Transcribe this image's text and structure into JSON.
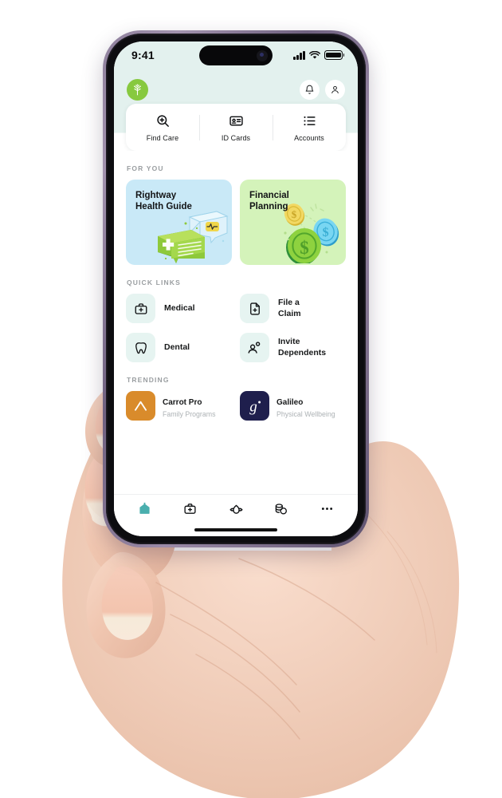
{
  "device": {
    "frame_color": "#7b6c8a",
    "bezel_color": "#0d0d10"
  },
  "status_bar": {
    "time": "9:41",
    "signal_icon": "cellular-bars-icon",
    "wifi_icon": "wifi-icon",
    "battery_icon": "battery-full-icon"
  },
  "header": {
    "logo_name": "tree-logo",
    "logo_color": "#87c93f",
    "background_color": "#e3f1ee",
    "actions": [
      {
        "name": "notifications-button",
        "icon": "bell-icon"
      },
      {
        "name": "profile-button",
        "icon": "person-icon"
      }
    ]
  },
  "quick_actions": [
    {
      "label": "Find Care",
      "icon": "search-plus-icon"
    },
    {
      "label": "ID Cards",
      "icon": "id-card-icon"
    },
    {
      "label": "Accounts",
      "icon": "list-icon"
    }
  ],
  "for_you": {
    "section_label": "FOR YOU",
    "cards": [
      {
        "title": "Rightway\nHealth Guide",
        "bg_color": "#c9e9f7",
        "art": "chat-bubbles-medical-illustration"
      },
      {
        "title": "Financial\nPlanning",
        "bg_color": "#d4f3ba",
        "art": "coins-dollar-illustration"
      }
    ]
  },
  "quick_links": {
    "section_label": "QUICK LINKS",
    "items": [
      {
        "label": "Medical",
        "icon": "medical-bag-icon"
      },
      {
        "label": "File a\nClaim",
        "icon": "file-plus-icon"
      },
      {
        "label": "Dental",
        "icon": "tooth-icon"
      },
      {
        "label": "Invite\nDependents",
        "icon": "people-add-icon"
      }
    ],
    "icon_bg_color": "#e6f4f1"
  },
  "trending": {
    "section_label": "TRENDING",
    "items": [
      {
        "name": "Carrot Pro",
        "subtitle": "Family Programs",
        "logo_glyph": "∧",
        "logo_bg": "#d98b2b",
        "logo_name": "carrot-pro-logo"
      },
      {
        "name": "Galileo",
        "subtitle": "Physical Wellbeing",
        "logo_glyph": "g",
        "logo_bg": "#1f1f4d",
        "logo_name": "galileo-logo"
      }
    ]
  },
  "bottom_nav": {
    "active_color": "#4aafae",
    "items": [
      {
        "name": "nav-home",
        "icon": "home-icon",
        "active": true
      },
      {
        "name": "nav-medical",
        "icon": "medical-bag-icon",
        "active": false
      },
      {
        "name": "nav-wellness",
        "icon": "lotus-icon",
        "active": false
      },
      {
        "name": "nav-finance",
        "icon": "coins-icon",
        "active": false
      },
      {
        "name": "nav-more",
        "icon": "ellipsis-icon",
        "active": false
      }
    ]
  }
}
